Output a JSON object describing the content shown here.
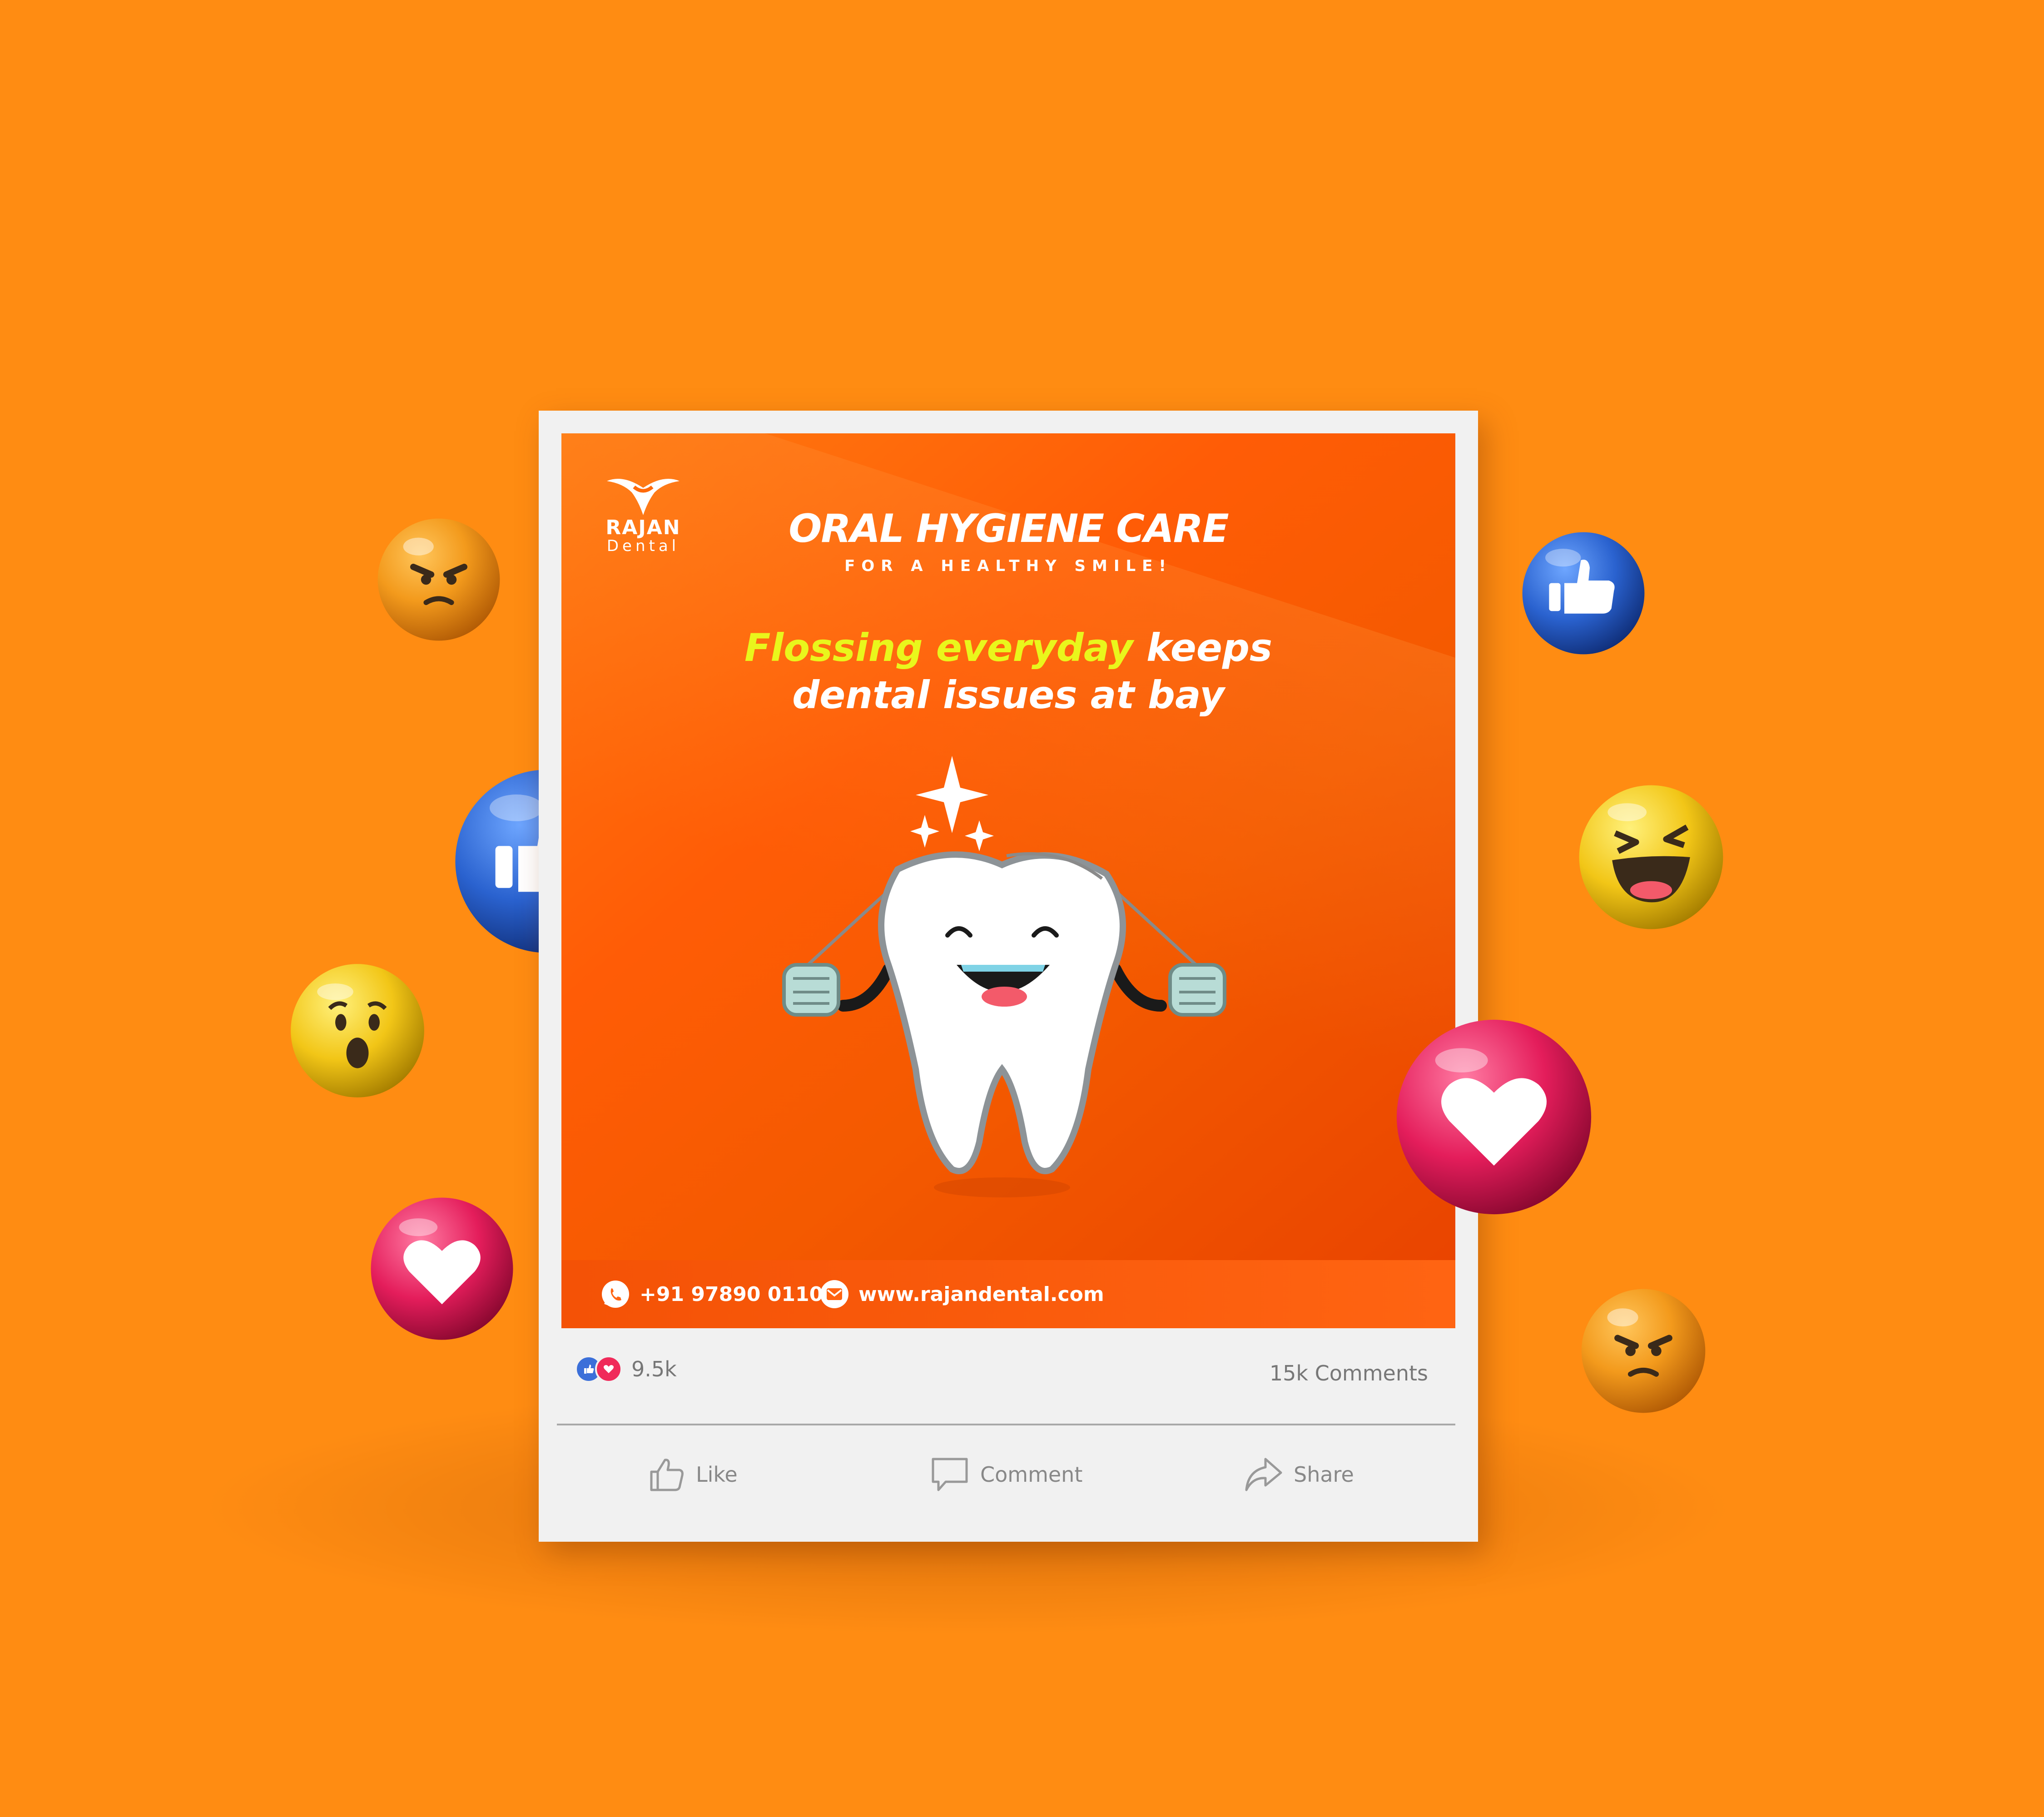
{
  "brand": {
    "name": "RAJAN",
    "sub": "Dental"
  },
  "post": {
    "headline": "ORAL HYGIENE CARE",
    "subhead": "FOR A HEALTHY SMILE!",
    "message_highlight": "Flossing everyday",
    "message_rest_line1": " keeps",
    "message_line2": "dental issues at bay"
  },
  "contact": {
    "phone": "+91 97890 01100",
    "website": "www.rajandental.com"
  },
  "stats": {
    "reactions": "9.5k",
    "comments": "15k Comments"
  },
  "actions": {
    "like": "Like",
    "comment": "Comment",
    "share": "Share"
  },
  "colors": {
    "background": "#ff8c12",
    "post_gradient_start": "#ff7a10",
    "post_gradient_end": "#e84200",
    "highlight": "#e9f61c",
    "card": "#f1f1f1",
    "like_blue": "#3b6fd9",
    "love_pink": "#f02a5a",
    "emoji_yellow": "#f2c617"
  },
  "floating_reactions": [
    "angry-emoji-icon",
    "like-emoji-icon",
    "wow-emoji-icon",
    "love-emoji-icon",
    "like-emoji-icon",
    "haha-emoji-icon",
    "love-emoji-icon",
    "angry-emoji-icon"
  ]
}
